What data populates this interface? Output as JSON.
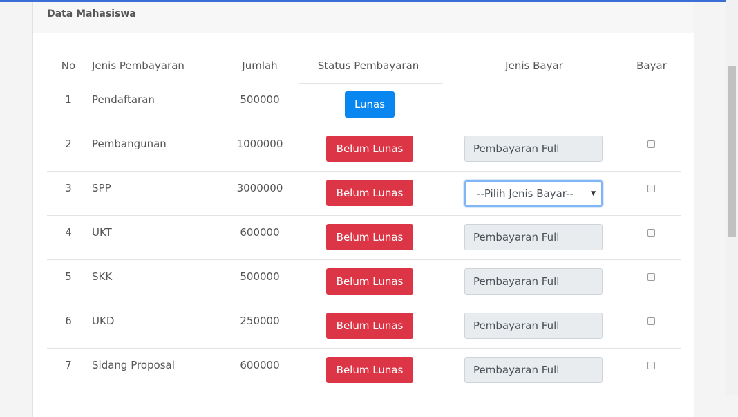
{
  "card": {
    "title": "Data Mahasiswa"
  },
  "table": {
    "headers": {
      "no": "No",
      "jenis": "Jenis Pembayaran",
      "jumlah": "Jumlah",
      "status": "Status Pembayaran",
      "jenis_bayar": "Jenis Bayar",
      "bayar": "Bayar"
    },
    "rows": [
      {
        "no": "1",
        "jenis": "Pendaftaran",
        "jumlah": "500000",
        "status": "Lunas"
      },
      {
        "no": "2",
        "jenis": "Pembangunan",
        "jumlah": "1000000",
        "status": "Belum Lunas",
        "jenis_bayar": "Pembayaran Full"
      },
      {
        "no": "3",
        "jenis": "SPP",
        "jumlah": "3000000",
        "status": "Belum Lunas",
        "jenis_bayar": "--Pilih Jenis Bayar--"
      },
      {
        "no": "4",
        "jenis": "UKT",
        "jumlah": "600000",
        "status": "Belum Lunas",
        "jenis_bayar": "Pembayaran Full"
      },
      {
        "no": "5",
        "jenis": "SKK",
        "jumlah": "500000",
        "status": "Belum Lunas",
        "jenis_bayar": "Pembayaran Full"
      },
      {
        "no": "6",
        "jenis": "UKD",
        "jumlah": "250000",
        "status": "Belum Lunas",
        "jenis_bayar": "Pembayaran Full"
      },
      {
        "no": "7",
        "jenis": "Sidang Proposal",
        "jumlah": "600000",
        "status": "Belum Lunas",
        "jenis_bayar": "Pembayaran Full"
      }
    ]
  },
  "colors": {
    "lunas": "#0a86f0",
    "belum_lunas": "#dc3545",
    "accent": "#3c6ed8"
  }
}
